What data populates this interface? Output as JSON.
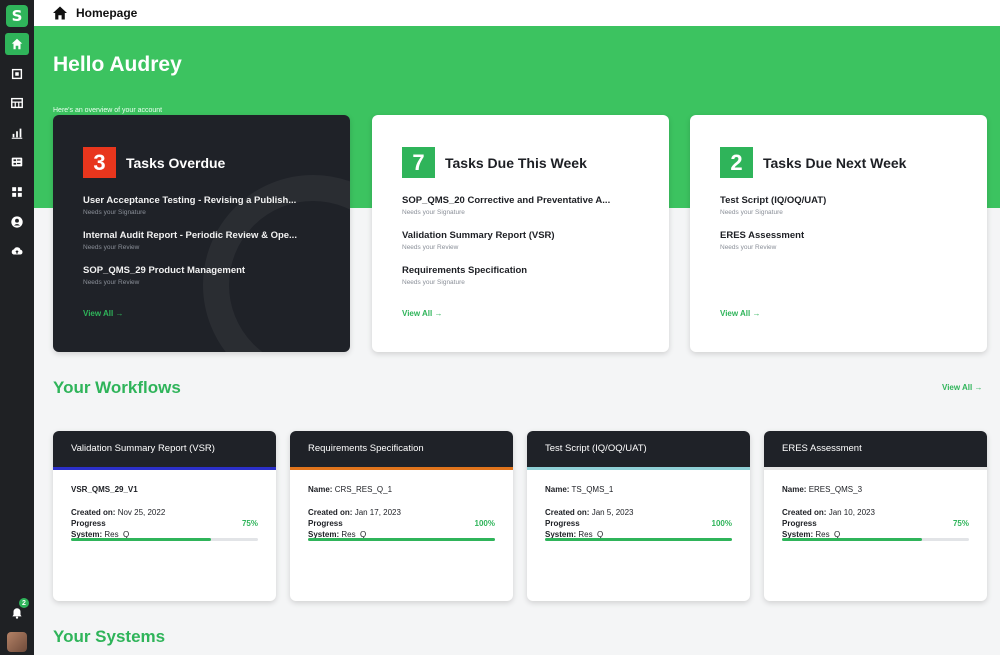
{
  "colors": {
    "brand_green": "#2fb45a",
    "overdue_red": "#e8361d",
    "dark_card": "#1f2228"
  },
  "sidebar": {
    "logo_letter": "S",
    "items": [
      {
        "icon": "home-icon",
        "active": true
      },
      {
        "icon": "document-scan-icon",
        "active": false
      },
      {
        "icon": "table-icon",
        "active": false
      },
      {
        "icon": "chart-icon",
        "active": false
      },
      {
        "icon": "list-card-icon",
        "active": false
      },
      {
        "icon": "grid-icon",
        "active": false
      },
      {
        "icon": "user-icon",
        "active": false
      },
      {
        "icon": "cloud-upload-icon",
        "active": false
      }
    ],
    "notification_count": "2"
  },
  "topbar": {
    "breadcrumb": "Homepage"
  },
  "hero": {
    "greeting": "Hello Audrey",
    "subtitle": "Here's an overview of your account"
  },
  "task_cards": [
    {
      "count": "3",
      "title": "Tasks Overdue",
      "items": [
        {
          "title": "User Acceptance Testing - Revising a Publish...",
          "status": "Needs your Signature"
        },
        {
          "title": "Internal Audit Report - Periodic Review & Ope...",
          "status": "Needs your Review"
        },
        {
          "title": "SOP_QMS_29 Product Management",
          "status": "Needs your Review"
        }
      ],
      "view_all": "View All →"
    },
    {
      "count": "7",
      "title": "Tasks Due This Week",
      "items": [
        {
          "title": "SOP_QMS_20 Corrective and Preventative A...",
          "status": "Needs your Signature"
        },
        {
          "title": "Validation Summary Report (VSR)",
          "status": "Needs your Review"
        },
        {
          "title": "Requirements Specification",
          "status": "Needs your Signature"
        }
      ],
      "view_all": "View All →"
    },
    {
      "count": "2",
      "title": "Tasks Due Next Week",
      "items": [
        {
          "title": "Test Script (IQ/OQ/UAT)",
          "status": "Needs your Signature"
        },
        {
          "title": "ERES Assessment",
          "status": "Needs your Review"
        }
      ],
      "view_all": "View All →"
    }
  ],
  "workflows": {
    "title": "Your Workflows",
    "view_all": "View All →",
    "progress_label": "Progress",
    "cards": [
      {
        "header": "Validation Summary Report (VSR)",
        "accent": "#2b2fc9",
        "name_label": "",
        "name": "VSR_QMS_29_V1",
        "created_label": "Created on:",
        "created": "Nov 25, 2022",
        "system_label": "System:",
        "system": "Res_Q",
        "progress": "75%",
        "progress_fraction": 0.75
      },
      {
        "header": "Requirements Specification",
        "accent": "#e0741c",
        "name_label": "Name:",
        "name": "CRS_RES_Q_1",
        "created_label": "Created on:",
        "created": "Jan 17, 2023",
        "system_label": "System:",
        "system": "Res_Q",
        "progress": "100%",
        "progress_fraction": 1.0
      },
      {
        "header": "Test Script (IQ/OQ/UAT)",
        "accent": "#8fd0d6",
        "name_label": "Name:",
        "name": "TS_QMS_1",
        "created_label": "Created on:",
        "created": "Jan 5, 2023",
        "system_label": "System:",
        "system": "Res_Q",
        "progress": "100%",
        "progress_fraction": 1.0
      },
      {
        "header": "ERES Assessment",
        "accent": "#e6e6e6",
        "name_label": "Name:",
        "name": "ERES_QMS_3",
        "created_label": "Created on:",
        "created": "Jan 10, 2023",
        "system_label": "System:",
        "system": "Res_Q",
        "progress": "75%",
        "progress_fraction": 0.75
      }
    ]
  },
  "systems": {
    "title": "Your Systems"
  }
}
